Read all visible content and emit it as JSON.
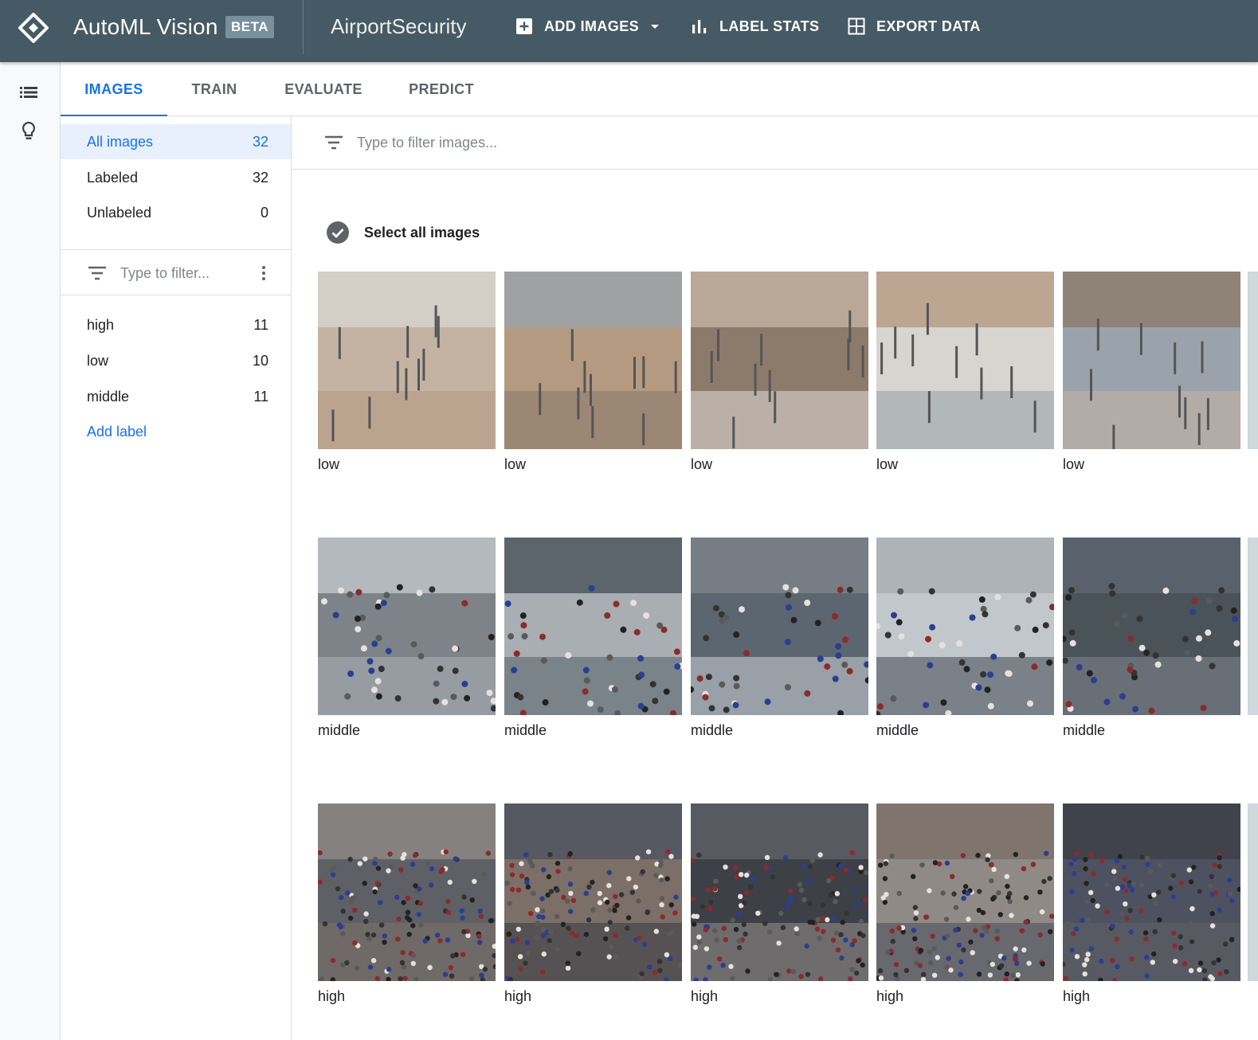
{
  "app": {
    "title": "AutoML Vision",
    "badge": "BETA",
    "dataset": "AirportSecurity",
    "actions": {
      "add_images": "ADD IMAGES",
      "label_stats": "LABEL STATS",
      "export_data": "EXPORT DATA"
    }
  },
  "tabs": [
    {
      "label": "IMAGES",
      "active": true
    },
    {
      "label": "TRAIN",
      "active": false
    },
    {
      "label": "EVALUATE",
      "active": false
    },
    {
      "label": "PREDICT",
      "active": false
    }
  ],
  "sidebar": {
    "categories": [
      {
        "label": "All images",
        "count": "32",
        "selected": true
      },
      {
        "label": "Labeled",
        "count": "32",
        "selected": false
      },
      {
        "label": "Unlabeled",
        "count": "0",
        "selected": false
      }
    ],
    "filter_placeholder": "Type to filter...",
    "labels": [
      {
        "name": "high",
        "count": "11"
      },
      {
        "name": "low",
        "count": "10"
      },
      {
        "name": "middle",
        "count": "11"
      }
    ],
    "add_label": "Add label"
  },
  "main": {
    "filter_placeholder": "Type to filter images...",
    "select_all": "Select all images",
    "rows": [
      {
        "label": "low",
        "crowd": 0
      },
      {
        "label": "middle",
        "crowd": 1
      },
      {
        "label": "high",
        "crowd": 2
      }
    ],
    "images": [
      [
        "low",
        "low",
        "low",
        "low",
        "low"
      ],
      [
        "middle",
        "middle",
        "middle",
        "middle",
        "middle"
      ],
      [
        "high",
        "high",
        "high",
        "high",
        "high"
      ]
    ]
  },
  "colors": {
    "appbar": "#455a64",
    "accent": "#1a73e8",
    "selected_bg": "#e8f0fe",
    "divider": "#dadce0"
  },
  "icons": {
    "logo": "automl-diamond-icon",
    "add_images": "add-box-icon",
    "dropdown": "arrow-drop-down-icon",
    "label_stats": "bar-chart-icon",
    "export_data": "grid-icon",
    "rail_list": "list-icon",
    "rail_idea": "lightbulb-icon",
    "filter": "filter-list-icon",
    "more": "more-vert-icon",
    "select_all": "check-circle-icon"
  }
}
